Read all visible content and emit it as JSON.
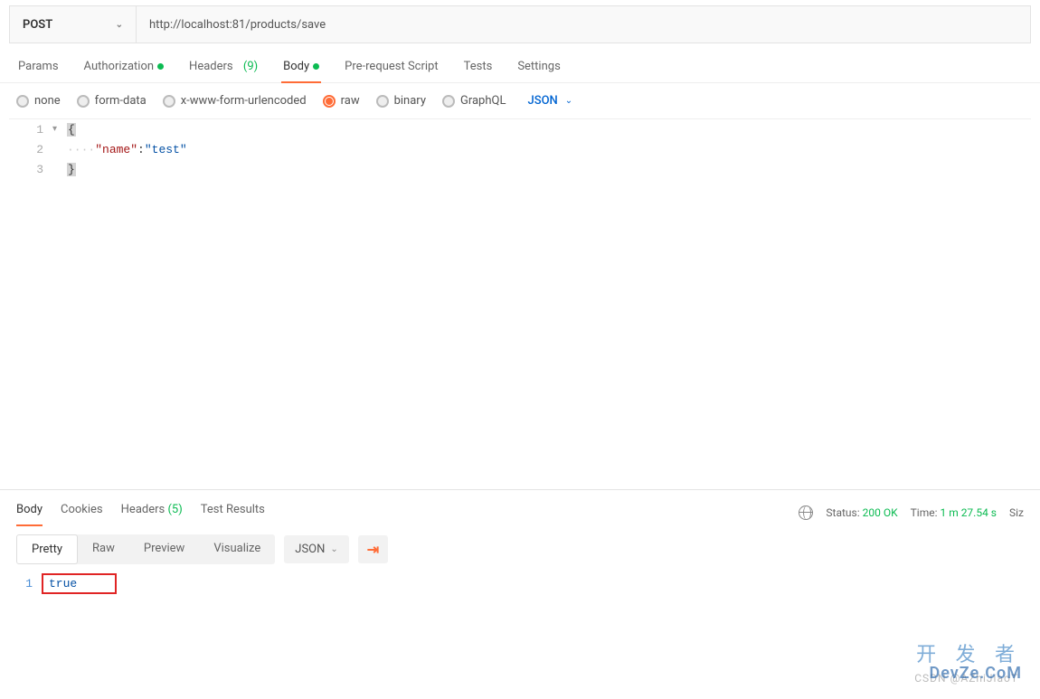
{
  "request": {
    "method": "POST",
    "url": "http://localhost:81/products/save"
  },
  "tabs": {
    "params": "Params",
    "auth": "Authorization",
    "headers_label": "Headers",
    "headers_count": "(9)",
    "body": "Body",
    "prerequest": "Pre-request Script",
    "tests": "Tests",
    "settings": "Settings"
  },
  "body_types": {
    "none": "none",
    "formdata": "form-data",
    "urlenc": "x-www-form-urlencoded",
    "raw": "raw",
    "binary": "binary",
    "graphql": "GraphQL",
    "format": "JSON"
  },
  "editor": {
    "line1_num": "1",
    "line1_code": "{",
    "line2_num": "2",
    "line2_dots": "····",
    "line2_key": "\"name\"",
    "line2_colon": ":",
    "line2_val": "\"test\"",
    "line3_num": "3",
    "line3_code": "}"
  },
  "response": {
    "tabs": {
      "body": "Body",
      "cookies": "Cookies",
      "headers_label": "Headers",
      "headers_count": "(5)",
      "test_results": "Test Results"
    },
    "meta": {
      "status_label": "Status:",
      "status_value": "200 OK",
      "time_label": "Time:",
      "time_value": "1 m 27.54 s",
      "size_label": "Siz"
    },
    "views": {
      "pretty": "Pretty",
      "raw": "Raw",
      "preview": "Preview",
      "visualize": "Visualize",
      "format": "JSON"
    },
    "body": {
      "line1_num": "1",
      "line1_val": "true"
    }
  },
  "watermark": {
    "line1": "开 发 者",
    "line2": "DevZe.CoM",
    "faint": "CSDN @AZhiJiaoT"
  }
}
